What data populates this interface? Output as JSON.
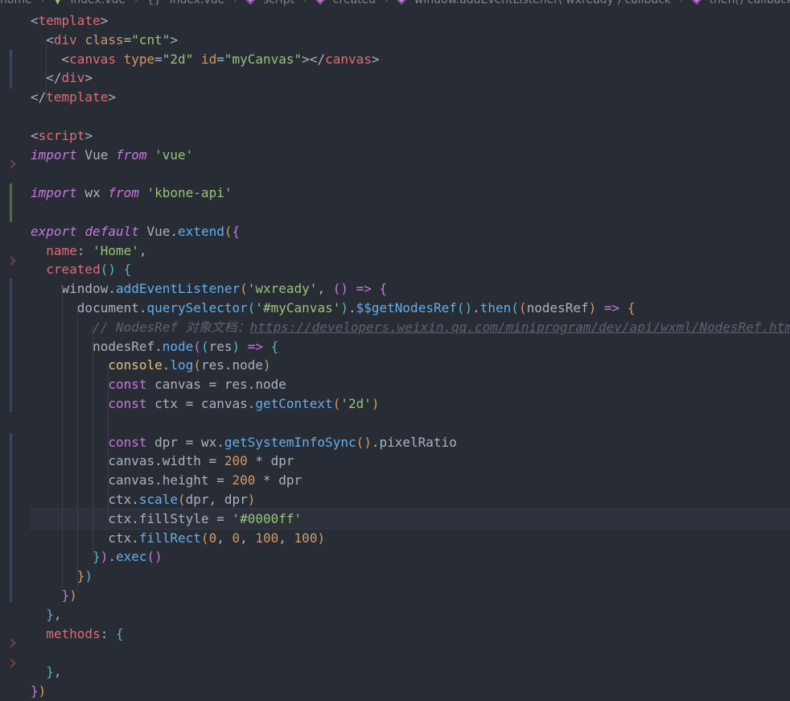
{
  "breadcrumb": {
    "items": [
      "home",
      "index.vue",
      "{}",
      "index.vue",
      "script",
      "created",
      "window.addEventListener('wxready') callback",
      "then() callback"
    ]
  },
  "lines": [
    [
      [
        "t-punc",
        "<"
      ],
      [
        "t-tag",
        "template"
      ],
      [
        "t-punc",
        ">"
      ]
    ],
    [
      [
        "t-plain",
        "  "
      ],
      [
        "t-punc",
        "<"
      ],
      [
        "t-tag",
        "div"
      ],
      [
        "t-plain",
        " "
      ],
      [
        "t-attr",
        "class"
      ],
      [
        "t-punc",
        "="
      ],
      [
        "t-str",
        "\"cnt\""
      ],
      [
        "t-punc",
        ">"
      ]
    ],
    [
      [
        "t-plain",
        "    "
      ],
      [
        "t-punc",
        "<"
      ],
      [
        "t-tag",
        "canvas"
      ],
      [
        "t-plain",
        " "
      ],
      [
        "t-attr",
        "type"
      ],
      [
        "t-punc",
        "="
      ],
      [
        "t-str",
        "\"2d\""
      ],
      [
        "t-plain",
        " "
      ],
      [
        "t-attr",
        "id"
      ],
      [
        "t-punc",
        "="
      ],
      [
        "t-str",
        "\"myCanvas\""
      ],
      [
        "t-punc",
        "></"
      ],
      [
        "t-tag",
        "canvas"
      ],
      [
        "t-punc",
        ">"
      ]
    ],
    [
      [
        "t-plain",
        "  "
      ],
      [
        "t-punc",
        "</"
      ],
      [
        "t-tag",
        "div"
      ],
      [
        "t-punc",
        ">"
      ]
    ],
    [
      [
        "t-punc",
        "</"
      ],
      [
        "t-tag",
        "template"
      ],
      [
        "t-punc",
        ">"
      ]
    ],
    [],
    [
      [
        "t-punc",
        "<"
      ],
      [
        "t-tag",
        "script"
      ],
      [
        "t-punc",
        ">"
      ]
    ],
    [
      [
        "t-kwi",
        "import"
      ],
      [
        "t-plain",
        " Vue "
      ],
      [
        "t-kwi",
        "from"
      ],
      [
        "t-plain",
        " "
      ],
      [
        "t-str",
        "'vue'"
      ]
    ],
    [],
    [
      [
        "t-kwi",
        "import"
      ],
      [
        "t-plain",
        " wx "
      ],
      [
        "t-kwi",
        "from"
      ],
      [
        "t-plain",
        " "
      ],
      [
        "t-str",
        "'kbone-api'"
      ]
    ],
    [],
    [
      [
        "t-kwi",
        "export"
      ],
      [
        "t-plain",
        " "
      ],
      [
        "t-kwi",
        "default"
      ],
      [
        "t-plain",
        " Vue."
      ],
      [
        "t-fn",
        "extend"
      ],
      [
        "t-brk",
        "("
      ],
      [
        "t-brk2",
        "{"
      ]
    ],
    [
      [
        "t-plain",
        "  "
      ],
      [
        "t-var",
        "name"
      ],
      [
        "t-plain",
        ": "
      ],
      [
        "t-str",
        "'Home'"
      ],
      [
        "t-plain",
        ","
      ]
    ],
    [
      [
        "t-plain",
        "  "
      ],
      [
        "t-var",
        "created"
      ],
      [
        "t-brk3",
        "()"
      ],
      [
        "t-plain",
        " "
      ],
      [
        "t-brk3",
        "{"
      ]
    ],
    [
      [
        "t-plain",
        "    window."
      ],
      [
        "t-fn",
        "addEventListener"
      ],
      [
        "t-brk",
        "("
      ],
      [
        "t-str",
        "'wxready'"
      ],
      [
        "t-plain",
        ", "
      ],
      [
        "t-brk2",
        "()"
      ],
      [
        "t-plain",
        " "
      ],
      [
        "t-kw",
        "=>"
      ],
      [
        "t-plain",
        " "
      ],
      [
        "t-brk2",
        "{"
      ]
    ],
    [
      [
        "t-plain",
        "      document."
      ],
      [
        "t-fn",
        "querySelector"
      ],
      [
        "t-brk3",
        "("
      ],
      [
        "t-str",
        "'#myCanvas'"
      ],
      [
        "t-brk3",
        ")"
      ],
      [
        "t-plain",
        "."
      ],
      [
        "t-fn",
        "$$getNodesRef"
      ],
      [
        "t-brk3",
        "()"
      ],
      [
        "t-plain",
        "."
      ],
      [
        "t-fn",
        "then"
      ],
      [
        "t-brk3",
        "("
      ],
      [
        "t-brk",
        "("
      ],
      [
        "t-plain",
        "nodesRef"
      ],
      [
        "t-brk",
        ")"
      ],
      [
        "t-plain",
        " "
      ],
      [
        "t-kw",
        "=>"
      ],
      [
        "t-plain",
        " "
      ],
      [
        "t-brk",
        "{"
      ]
    ],
    [
      [
        "t-plain",
        "        "
      ],
      [
        "t-com",
        "// NodesRef 对象文档："
      ],
      [
        "t-url",
        "https://developers.weixin.qq.com/miniprogram/dev/api/wxml/NodesRef.html"
      ]
    ],
    [
      [
        "t-plain",
        "        nodesRef."
      ],
      [
        "t-fn",
        "node"
      ],
      [
        "t-brk2",
        "("
      ],
      [
        "t-brk3",
        "("
      ],
      [
        "t-plain",
        "res"
      ],
      [
        "t-brk3",
        ")"
      ],
      [
        "t-plain",
        " "
      ],
      [
        "t-kw",
        "=>"
      ],
      [
        "t-plain",
        " "
      ],
      [
        "t-brk3",
        "{"
      ]
    ],
    [
      [
        "t-plain",
        "          "
      ],
      [
        "t-cls",
        "console"
      ],
      [
        "t-plain",
        "."
      ],
      [
        "t-fn",
        "log"
      ],
      [
        "t-brk",
        "("
      ],
      [
        "t-plain",
        "res.node"
      ],
      [
        "t-brk",
        ")"
      ]
    ],
    [
      [
        "t-plain",
        "          "
      ],
      [
        "t-kw",
        "const"
      ],
      [
        "t-plain",
        " canvas = res.node"
      ]
    ],
    [
      [
        "t-plain",
        "          "
      ],
      [
        "t-kw",
        "const"
      ],
      [
        "t-plain",
        " ctx = canvas."
      ],
      [
        "t-fn",
        "getContext"
      ],
      [
        "t-brk",
        "("
      ],
      [
        "t-str",
        "'2d'"
      ],
      [
        "t-brk",
        ")"
      ]
    ],
    [],
    [
      [
        "t-plain",
        "          "
      ],
      [
        "t-kw",
        "const"
      ],
      [
        "t-plain",
        " dpr = wx."
      ],
      [
        "t-fn",
        "getSystemInfoSync"
      ],
      [
        "t-brk",
        "()"
      ],
      [
        "t-plain",
        ".pixelRatio"
      ]
    ],
    [
      [
        "t-plain",
        "          canvas.width = "
      ],
      [
        "t-num",
        "200"
      ],
      [
        "t-plain",
        " * dpr"
      ]
    ],
    [
      [
        "t-plain",
        "          canvas.height = "
      ],
      [
        "t-num",
        "200"
      ],
      [
        "t-plain",
        " * dpr"
      ]
    ],
    [
      [
        "t-plain",
        "          ctx."
      ],
      [
        "t-fn",
        "scale"
      ],
      [
        "t-brk",
        "("
      ],
      [
        "t-plain",
        "dpr, dpr"
      ],
      [
        "t-brk",
        ")"
      ]
    ],
    [
      [
        "t-plain",
        "          ctx.fillStyle = "
      ],
      [
        "t-str",
        "'#0000ff'"
      ]
    ],
    [
      [
        "t-plain",
        "          ctx."
      ],
      [
        "t-fn",
        "fillRect"
      ],
      [
        "t-brk",
        "("
      ],
      [
        "t-num",
        "0"
      ],
      [
        "t-plain",
        ", "
      ],
      [
        "t-num",
        "0"
      ],
      [
        "t-plain",
        ", "
      ],
      [
        "t-num",
        "100"
      ],
      [
        "t-plain",
        ", "
      ],
      [
        "t-num",
        "100"
      ],
      [
        "t-brk",
        ")"
      ]
    ],
    [
      [
        "t-plain",
        "        "
      ],
      [
        "t-brk3",
        "}"
      ],
      [
        "t-brk2",
        ")"
      ],
      [
        "t-plain",
        "."
      ],
      [
        "t-fn",
        "exec"
      ],
      [
        "t-brk2",
        "()"
      ]
    ],
    [
      [
        "t-plain",
        "      "
      ],
      [
        "t-brk",
        "}"
      ],
      [
        "t-brk3",
        ")"
      ]
    ],
    [
      [
        "t-plain",
        "    "
      ],
      [
        "t-brk2",
        "}"
      ],
      [
        "t-brk",
        ")"
      ]
    ],
    [
      [
        "t-plain",
        "  "
      ],
      [
        "t-brk3",
        "}"
      ],
      [
        "t-plain",
        ","
      ]
    ],
    [
      [
        "t-plain",
        "  "
      ],
      [
        "t-var",
        "methods"
      ],
      [
        "t-plain",
        ": "
      ],
      [
        "t-brk3",
        "{"
      ]
    ],
    [],
    [
      [
        "t-plain",
        "  "
      ],
      [
        "t-brk3",
        "}"
      ],
      [
        "t-plain",
        ","
      ]
    ],
    [
      [
        "t-brk2",
        "}"
      ],
      [
        "t-brk",
        ")"
      ]
    ]
  ],
  "colors": {
    "background": "#282c34",
    "current_line": "#2c313c",
    "tag": "#e06c75",
    "string": "#98c379",
    "keyword": "#c678dd",
    "function": "#61afef",
    "number": "#d19a66",
    "comment": "#5c6370"
  },
  "icons": {
    "breadcrumb_vue": "vue-file-icon",
    "breadcrumb_module": "module-braces-icon",
    "breadcrumb_method": "cube-method-icon",
    "fold": "fold-chevron-icon"
  }
}
